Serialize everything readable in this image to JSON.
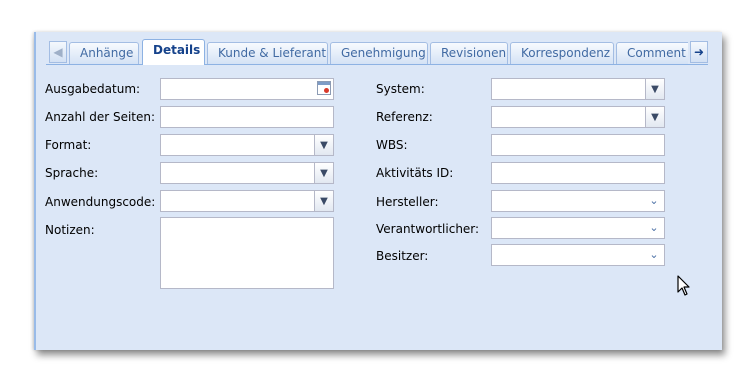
{
  "tabs": {
    "scroll_left_icon": "arrow-left-icon",
    "scroll_right_icon": "arrow-right-icon",
    "items": [
      {
        "label": "Anhänge"
      },
      {
        "label": "Details"
      },
      {
        "label": "Kunde & Lieferant"
      },
      {
        "label": "Genehmigung"
      },
      {
        "label": "Revisionen"
      },
      {
        "label": "Korrespondenz"
      },
      {
        "label": "Comment R"
      }
    ],
    "active_index": 1
  },
  "left_form": {
    "ausgabedatum": {
      "label": "Ausgabedatum:",
      "value": ""
    },
    "anzahl_seiten": {
      "label": "Anzahl der Seiten:",
      "value": ""
    },
    "format": {
      "label": "Format:",
      "value": ""
    },
    "sprache": {
      "label": "Sprache:",
      "value": ""
    },
    "anwendungscode": {
      "label": "Anwendungscode:",
      "value": ""
    },
    "notizen": {
      "label": "Notizen:",
      "value": ""
    }
  },
  "right_form": {
    "system": {
      "label": "System:",
      "value": ""
    },
    "referenz": {
      "label": "Referenz:",
      "value": ""
    },
    "wbs": {
      "label": "WBS:",
      "value": ""
    },
    "aktivitaets_id": {
      "label": "Aktivitäts ID:",
      "value": ""
    },
    "hersteller": {
      "label": "Hersteller:",
      "value": ""
    },
    "verantwortlicher": {
      "label": "Verantwortlicher:",
      "value": ""
    },
    "besitzer": {
      "label": "Besitzer:",
      "value": ""
    }
  },
  "colors": {
    "panel_bg": "#dce7f7",
    "tab_active_text": "#15428b",
    "tab_text": "#416aa3",
    "field_border": "#b5b8c8"
  }
}
